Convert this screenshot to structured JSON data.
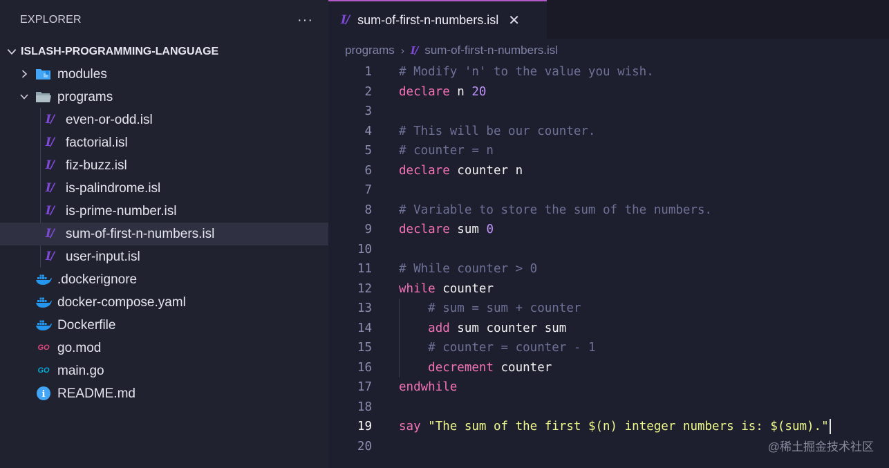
{
  "sidebar": {
    "title": "EXPLORER",
    "more_label": "···",
    "project": "ISLASH-PROGRAMMING-LANGUAGE",
    "items": [
      {
        "label": "modules",
        "icon": "folder-modules-icon",
        "kind": "folder-collapsed"
      },
      {
        "label": "programs",
        "icon": "folder-open-icon",
        "kind": "folder-expanded"
      },
      {
        "label": "even-or-odd.isl",
        "icon": "islash-file-icon"
      },
      {
        "label": "factorial.isl",
        "icon": "islash-file-icon"
      },
      {
        "label": "fiz-buzz.isl",
        "icon": "islash-file-icon"
      },
      {
        "label": "is-palindrome.isl",
        "icon": "islash-file-icon"
      },
      {
        "label": "is-prime-number.isl",
        "icon": "islash-file-icon"
      },
      {
        "label": "sum-of-first-n-numbers.isl",
        "icon": "islash-file-icon",
        "selected": true
      },
      {
        "label": "user-input.isl",
        "icon": "islash-file-icon"
      },
      {
        "label": ".dockerignore",
        "icon": "docker-icon"
      },
      {
        "label": "docker-compose.yaml",
        "icon": "docker-icon"
      },
      {
        "label": "Dockerfile",
        "icon": "docker-icon"
      },
      {
        "label": "go.mod",
        "icon": "go-mod-icon"
      },
      {
        "label": "main.go",
        "icon": "go-icon"
      },
      {
        "label": "README.md",
        "icon": "info-icon"
      }
    ]
  },
  "icon_glyphs": {
    "islash": "I/",
    "go": "GO",
    "info": "i"
  },
  "tab": {
    "label": "sum-of-first-n-numbers.isl",
    "close": "✕"
  },
  "breadcrumb": {
    "folder": "programs",
    "separator": "›",
    "file": "sum-of-first-n-numbers.isl"
  },
  "code": {
    "current_line": 19,
    "lines": [
      {
        "n": "1",
        "tokens": [
          [
            "c",
            "# Modify 'n' to the value you wish."
          ]
        ]
      },
      {
        "n": "2",
        "tokens": [
          [
            "k",
            "declare"
          ],
          [
            "i",
            " n "
          ],
          [
            "m",
            "20"
          ]
        ]
      },
      {
        "n": "3",
        "tokens": []
      },
      {
        "n": "4",
        "tokens": [
          [
            "c",
            "# This will be our counter."
          ]
        ]
      },
      {
        "n": "5",
        "tokens": [
          [
            "c",
            "# counter = n"
          ]
        ]
      },
      {
        "n": "6",
        "tokens": [
          [
            "k",
            "declare"
          ],
          [
            "i",
            " counter n"
          ]
        ]
      },
      {
        "n": "7",
        "tokens": []
      },
      {
        "n": "8",
        "tokens": [
          [
            "c",
            "# Variable to store the sum of the numbers."
          ]
        ]
      },
      {
        "n": "9",
        "tokens": [
          [
            "k",
            "declare"
          ],
          [
            "i",
            " sum "
          ],
          [
            "m",
            "0"
          ]
        ]
      },
      {
        "n": "10",
        "tokens": []
      },
      {
        "n": "11",
        "tokens": [
          [
            "c",
            "# While counter > 0"
          ]
        ]
      },
      {
        "n": "12",
        "tokens": [
          [
            "k",
            "while"
          ],
          [
            "i",
            " counter"
          ]
        ]
      },
      {
        "n": "13",
        "tokens": [
          [
            "i",
            "    "
          ],
          [
            "c",
            "# sum = sum + counter"
          ]
        ]
      },
      {
        "n": "14",
        "tokens": [
          [
            "i",
            "    "
          ],
          [
            "k",
            "add"
          ],
          [
            "i",
            " sum counter sum"
          ]
        ]
      },
      {
        "n": "15",
        "tokens": [
          [
            "i",
            "    "
          ],
          [
            "c",
            "# counter = counter - 1"
          ]
        ]
      },
      {
        "n": "16",
        "tokens": [
          [
            "i",
            "    "
          ],
          [
            "k",
            "decrement"
          ],
          [
            "i",
            " counter"
          ]
        ]
      },
      {
        "n": "17",
        "tokens": [
          [
            "k",
            "endwhile"
          ]
        ]
      },
      {
        "n": "18",
        "tokens": []
      },
      {
        "n": "19",
        "tokens": [
          [
            "k",
            "say"
          ],
          [
            "i",
            " "
          ],
          [
            "s",
            "\"The sum of the first $(n) integer numbers is: $(sum).\""
          ]
        ]
      },
      {
        "n": "20",
        "tokens": []
      }
    ]
  },
  "watermark": "@稀土掘金技术社区",
  "colors": {
    "keyword": "#f472b6",
    "comment": "#6e7196",
    "number": "#bd93f9",
    "string": "#f1fa8c",
    "identifier": "#f2f2f2",
    "tab_accent": "#b15ac8",
    "docker": "#2496ed",
    "go": "#00add8",
    "go_mod": "#e0457b",
    "info": "#42a5f5",
    "folder_modules": "#42a5f5",
    "folder": "#90a4ae"
  }
}
